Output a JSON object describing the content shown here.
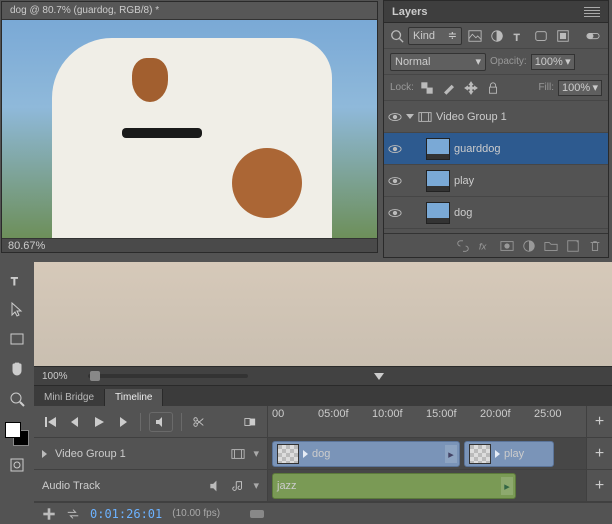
{
  "doc": {
    "title": "dog @ 80.7% (guardog, RGB/8) *",
    "zoom": "80.67%"
  },
  "layers": {
    "title": "Layers",
    "filter_label": "Kind",
    "blend_mode": "Normal",
    "opacity_label": "Opacity:",
    "opacity_value": "100%",
    "lock_label": "Lock:",
    "fill_label": "Fill:",
    "fill_value": "100%",
    "group": "Video Group 1",
    "items": [
      {
        "name": "guarddog"
      },
      {
        "name": "play"
      },
      {
        "name": "dog"
      }
    ]
  },
  "preview": {
    "zoom": "100%"
  },
  "tabs": {
    "bridge": "Mini Bridge",
    "timeline": "Timeline"
  },
  "timeline": {
    "ruler": [
      "00",
      "05:00f",
      "10:00f",
      "15:00f",
      "20:00f",
      "25:00"
    ],
    "group_name": "Video Group 1",
    "audio_label": "Audio Track",
    "clips": {
      "dog": "dog",
      "play": "play",
      "jazz": "jazz"
    },
    "timecode": "0:01:26:01",
    "fps": "(10.00 fps)"
  }
}
